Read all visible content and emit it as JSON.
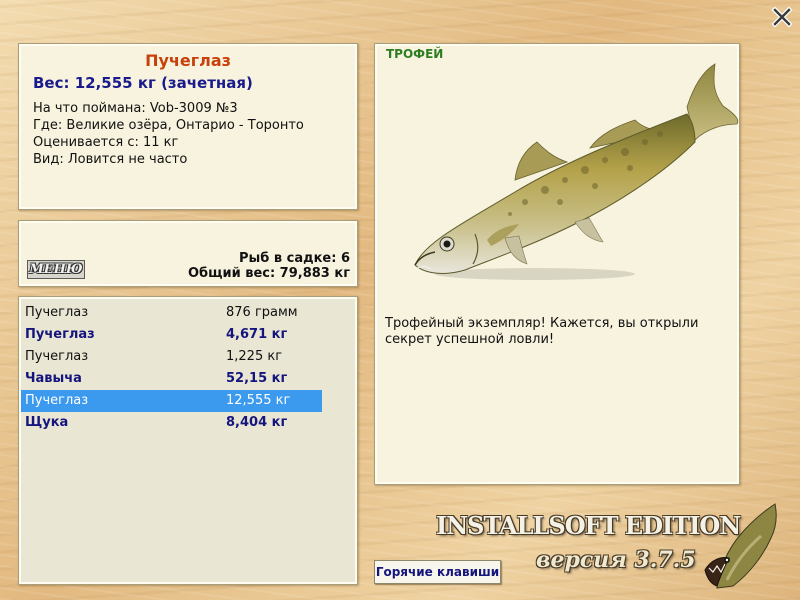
{
  "window": {
    "close_label": "X"
  },
  "fish_info": {
    "name": "Пучеглаз",
    "weight": "Вес: 12,555 кг (зачетная)",
    "lines": [
      "На что поймана: Vob-3009 №3",
      "Где: Великие озёра, Онтарио - Торонто",
      "Оценивается с: 11 кг",
      "Вид: Ловится не часто"
    ]
  },
  "stats": {
    "menu_label": "МЕНЮ",
    "fish_in_cage": "Рыб в садке: 6",
    "total_weight": "Общий вес: 79,883 кг"
  },
  "catch_list": [
    {
      "name": "Пучеглаз",
      "weight": "876 грамм",
      "bold": false,
      "selected": false
    },
    {
      "name": "Пучеглаз",
      "weight": "4,671 кг",
      "bold": true,
      "selected": false
    },
    {
      "name": "Пучеглаз",
      "weight": "1,225 кг",
      "bold": false,
      "selected": false
    },
    {
      "name": "Чавыча",
      "weight": "52,15 кг",
      "bold": true,
      "selected": false
    },
    {
      "name": "Пучеглаз",
      "weight": "12,555 кг",
      "bold": false,
      "selected": true
    },
    {
      "name": "Щука",
      "weight": "8,404 кг",
      "bold": true,
      "selected": false
    }
  ],
  "trophy": {
    "label": "ТРОФЕЙ",
    "description": "Трофейный экземпляр! Кажется, вы открыли секрет успешной ловли!"
  },
  "branding": {
    "edition": "INSTALLSOFT EDITION",
    "version": "версия 3.7.5"
  },
  "footer": {
    "hotkeys_label": "Горячие клавиши"
  },
  "colors": {
    "fish_name": "#c8400a",
    "bold_text": "#15157e",
    "selection": "#3b99ee",
    "trophy_label": "#2e7d22",
    "panel_bg": "#f7f3de"
  },
  "icons": {
    "close": "close-icon",
    "fish": "walleye-fish-image",
    "logo": "pike-logo-icon"
  }
}
